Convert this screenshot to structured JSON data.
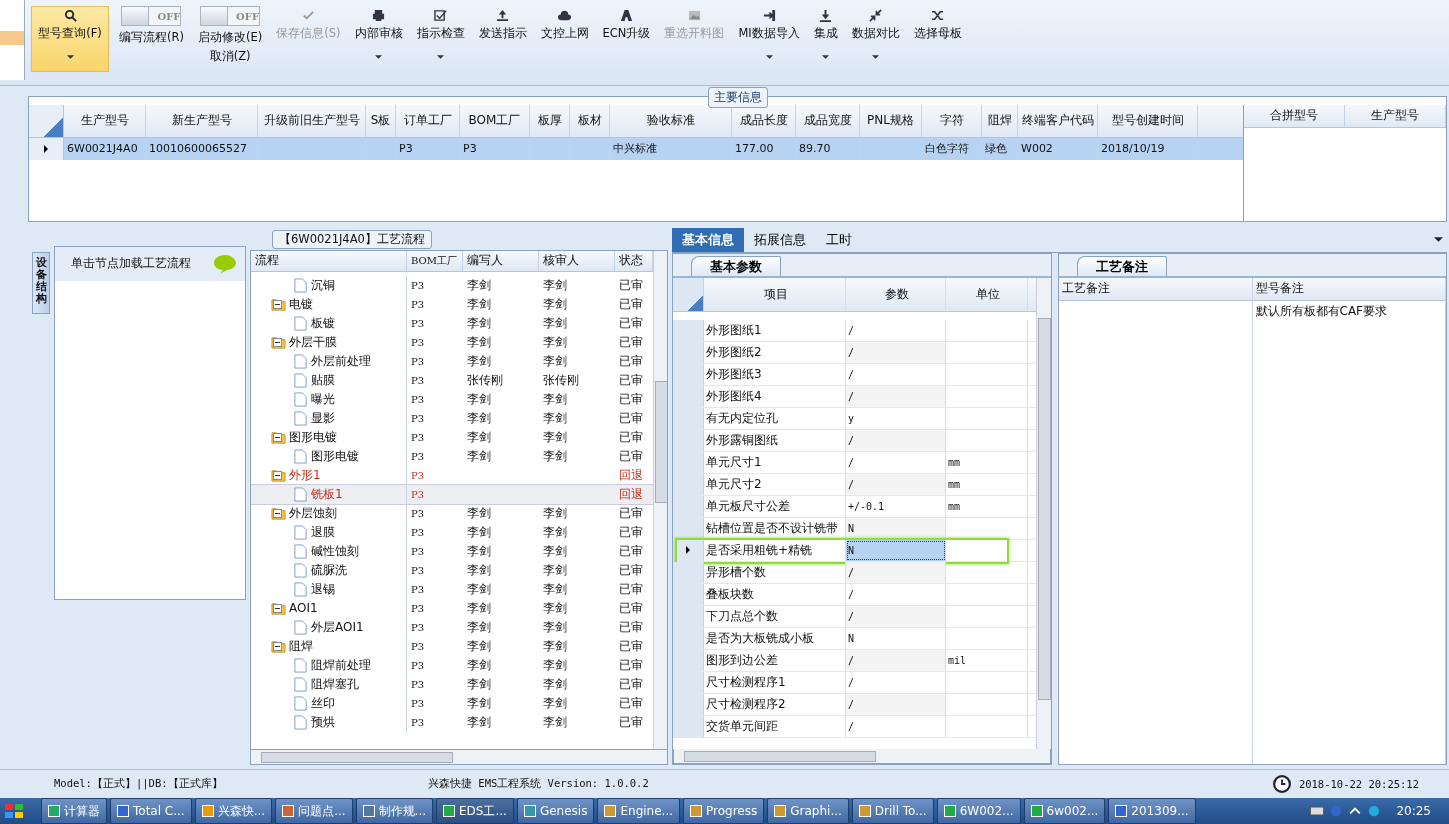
{
  "toolbar": [
    {
      "kind": "button",
      "label": "型号查询(F)",
      "selected": true,
      "disabled": false,
      "dropdown": true
    },
    {
      "kind": "toggle",
      "toggle": "OFF",
      "on": false,
      "label": "编写流程(R)"
    },
    {
      "kind": "toggle",
      "toggle": "OFF",
      "on": false,
      "label": "启动修改(E)",
      "label2": "取消(Z)"
    },
    {
      "kind": "button",
      "label": "保存信息(S)",
      "selected": false,
      "disabled": true,
      "dropdown": false
    },
    {
      "kind": "button",
      "label": "内部审核",
      "selected": false,
      "disabled": false,
      "dropdown": true
    },
    {
      "kind": "button",
      "label": "指示检查",
      "selected": false,
      "disabled": false,
      "dropdown": true
    },
    {
      "kind": "button",
      "label": "发送指示",
      "selected": false,
      "disabled": false,
      "dropdown": false
    },
    {
      "kind": "button",
      "label": "文控上网",
      "selected": false,
      "disabled": false,
      "dropdown": false
    },
    {
      "kind": "button",
      "label": "ECN升级",
      "selected": false,
      "disabled": false,
      "dropdown": false
    },
    {
      "kind": "button",
      "label": "重选开料图",
      "selected": false,
      "disabled": true,
      "dropdown": false
    },
    {
      "kind": "button",
      "label": "MI数据导入",
      "selected": false,
      "disabled": false,
      "dropdown": true
    },
    {
      "kind": "button",
      "label": "集成",
      "selected": false,
      "disabled": false,
      "dropdown": true
    },
    {
      "kind": "button",
      "label": "数据对比",
      "selected": false,
      "disabled": false,
      "dropdown": true
    },
    {
      "kind": "button",
      "label": "选择母板",
      "selected": false,
      "disabled": false,
      "dropdown": false
    }
  ],
  "main_info": {
    "title": "主要信息",
    "columns": [
      "生产型号",
      "新生产型号",
      "升级前旧生产型号",
      "S板",
      "订单工厂",
      "BOM工厂",
      "板厚",
      "板材",
      "验收标准",
      "成品长度",
      "成品宽度",
      "PNL规格",
      "字符",
      "阻焊",
      "终端客户代码",
      "型号创建时间"
    ],
    "rows": [
      {
        "selected": true,
        "cells": [
          "6W0021J4A0",
          "10010600065527",
          "",
          "",
          "P3",
          "P3",
          "",
          "",
          "中兴标准",
          "177.00",
          "89.70",
          "",
          "白色字符",
          "绿色",
          "W002",
          "2018/10/19"
        ]
      }
    ],
    "merge_columns": [
      "合拼型号",
      "生产型号"
    ]
  },
  "side_tab": "设备结构",
  "side_panel": {
    "title": "单击节点加载工艺流程"
  },
  "flow": {
    "title": "【6W0021J4A0】工艺流程",
    "columns": [
      "流程",
      "BOM工厂",
      "编写人",
      "核审人",
      "状态"
    ],
    "tree": [
      {
        "children": [
          {
            "label": "沉铜",
            "factory": "P3",
            "writer": "李剑",
            "reviewer": "李剑",
            "status": "已审",
            "returned": false,
            "selected": false
          }
        ]
      },
      {
        "label": "电镀",
        "factory": "P3",
        "writer": "李剑",
        "reviewer": "李剑",
        "status": "已审",
        "returned": false,
        "selected": false,
        "children": [
          {
            "label": "板镀",
            "factory": "P3",
            "writer": "李剑",
            "reviewer": "李剑",
            "status": "已审",
            "returned": false,
            "selected": false
          }
        ]
      },
      {
        "label": "外层干膜",
        "factory": "P3",
        "writer": "李剑",
        "reviewer": "李剑",
        "status": "已审",
        "returned": false,
        "selected": false,
        "children": [
          {
            "label": "外层前处理",
            "factory": "P3",
            "writer": "李剑",
            "reviewer": "李剑",
            "status": "已审",
            "returned": false,
            "selected": false
          },
          {
            "label": "贴膜",
            "factory": "P3",
            "writer": "张传刚",
            "reviewer": "张传刚",
            "status": "已审",
            "returned": false,
            "selected": false
          },
          {
            "label": "曝光",
            "factory": "P3",
            "writer": "李剑",
            "reviewer": "李剑",
            "status": "已审",
            "returned": false,
            "selected": false
          },
          {
            "label": "显影",
            "factory": "P3",
            "writer": "李剑",
            "reviewer": "李剑",
            "status": "已审",
            "returned": false,
            "selected": false
          }
        ]
      },
      {
        "label": "图形电镀",
        "factory": "P3",
        "writer": "李剑",
        "reviewer": "李剑",
        "status": "已审",
        "returned": false,
        "selected": false,
        "children": [
          {
            "label": "图形电镀",
            "factory": "P3",
            "writer": "李剑",
            "reviewer": "李剑",
            "status": "已审",
            "returned": false,
            "selected": false
          }
        ]
      },
      {
        "label": "外形1",
        "factory": "P3",
        "status": "回退",
        "returned": true,
        "selected": false,
        "children": [
          {
            "label": "铣板1",
            "factory": "P3",
            "status": "回退",
            "returned": true,
            "selected": true
          }
        ]
      },
      {
        "label": "外层蚀刻",
        "factory": "P3",
        "writer": "李剑",
        "reviewer": "李剑",
        "status": "已审",
        "returned": false,
        "selected": false,
        "children": [
          {
            "label": "退膜",
            "factory": "P3",
            "writer": "李剑",
            "reviewer": "李剑",
            "status": "已审",
            "returned": false,
            "selected": false
          },
          {
            "label": "碱性蚀刻",
            "factory": "P3",
            "writer": "李剑",
            "reviewer": "李剑",
            "status": "已审",
            "returned": false,
            "selected": false
          },
          {
            "label": "硫脲洗",
            "factory": "P3",
            "writer": "李剑",
            "reviewer": "李剑",
            "status": "已审",
            "returned": false,
            "selected": false
          },
          {
            "label": "退锡",
            "factory": "P3",
            "writer": "李剑",
            "reviewer": "李剑",
            "status": "已审",
            "returned": false,
            "selected": false
          }
        ]
      },
      {
        "label": "AOI1",
        "factory": "P3",
        "writer": "李剑",
        "reviewer": "李剑",
        "status": "已审",
        "returned": false,
        "selected": false,
        "children": [
          {
            "label": "外层AOI1",
            "factory": "P3",
            "writer": "李剑",
            "reviewer": "李剑",
            "status": "已审",
            "returned": false,
            "selected": false
          }
        ]
      },
      {
        "label": "阻焊",
        "factory": "P3",
        "writer": "李剑",
        "reviewer": "李剑",
        "status": "已审",
        "returned": false,
        "selected": false,
        "children": [
          {
            "label": "阻焊前处理",
            "factory": "P3",
            "writer": "李剑",
            "reviewer": "李剑",
            "status": "已审",
            "returned": false,
            "selected": false
          },
          {
            "label": "阻焊塞孔",
            "factory": "P3",
            "writer": "李剑",
            "reviewer": "李剑",
            "status": "已审",
            "returned": false,
            "selected": false
          },
          {
            "label": "丝印",
            "factory": "P3",
            "writer": "李剑",
            "reviewer": "李剑",
            "status": "已审",
            "returned": false,
            "selected": false
          },
          {
            "label": "预烘",
            "factory": "P3",
            "writer": "李剑",
            "reviewer": "李剑",
            "status": "已审",
            "returned": false,
            "selected": false
          }
        ]
      }
    ]
  },
  "tabs": [
    {
      "label": "基本信息",
      "selected": true
    },
    {
      "label": "拓展信息",
      "selected": false
    },
    {
      "label": "工时",
      "selected": false
    }
  ],
  "params": {
    "tab": "基本参数",
    "columns": [
      "项目",
      "参数",
      "单位"
    ],
    "rows": [
      {
        "item": "外形图纸1",
        "value": "/",
        "selected": false
      },
      {
        "item": "外形图纸2",
        "value": "/",
        "selected": false
      },
      {
        "item": "外形图纸3",
        "value": "/",
        "selected": false
      },
      {
        "item": "外形图纸4",
        "value": "/",
        "selected": false
      },
      {
        "item": "有无内定位孔",
        "value": "y",
        "selected": false
      },
      {
        "item": "外形露铜图纸",
        "value": "/",
        "selected": false
      },
      {
        "item": "单元尺寸1",
        "value": "/",
        "unit": "mm",
        "selected": false
      },
      {
        "item": "单元尺寸2",
        "value": "/",
        "unit": "mm",
        "selected": false
      },
      {
        "item": "单元板尺寸公差",
        "value": "+/-0.1",
        "unit": "mm",
        "selected": false
      },
      {
        "item": "钻槽位置是否不设计铣带",
        "value": "N",
        "selected": false
      },
      {
        "item": "是否采用粗铣+精铣",
        "value": "N",
        "selected": true
      },
      {
        "item": "异形槽个数",
        "value": "/",
        "selected": false
      },
      {
        "item": "叠板块数",
        "value": "/",
        "selected": false
      },
      {
        "item": "下刀点总个数",
        "value": "/",
        "selected": false
      },
      {
        "item": "是否为大板铣成小板",
        "value": "N",
        "selected": false
      },
      {
        "item": "图形到边公差",
        "value": "/",
        "unit": "mil",
        "selected": false
      },
      {
        "item": "尺寸检测程序1",
        "value": "/",
        "selected": false
      },
      {
        "item": "尺寸检测程序2",
        "value": "/",
        "selected": false
      },
      {
        "item": "交货单元间距",
        "value": "/",
        "selected": false
      }
    ]
  },
  "remarks": {
    "tab": "工艺备注",
    "columns": [
      {
        "label": "工艺备注"
      },
      {
        "label": "型号备注",
        "value": "默认所有板都有CAF要求"
      }
    ]
  },
  "status_bar": {
    "model": "Model:【正式】||DB:【正式库】",
    "app": "兴森快捷 EMS工程系统 Version: 1.0.0.2",
    "datetime": "2018-10-22 20:25:12"
  },
  "taskbar": {
    "items": [
      {
        "label": "计算器",
        "selected": false
      },
      {
        "label": "Total C...",
        "selected": false
      },
      {
        "label": "兴森快...",
        "selected": false
      },
      {
        "label": "问题点...",
        "selected": false
      },
      {
        "label": "制作规...",
        "selected": false
      },
      {
        "label": "EDS工...",
        "selected": true
      },
      {
        "label": "Genesis",
        "selected": false
      },
      {
        "label": "Engine...",
        "selected": false
      },
      {
        "label": "Progress",
        "selected": false
      },
      {
        "label": "Graphi...",
        "selected": false
      },
      {
        "label": "Drill To...",
        "selected": false
      },
      {
        "label": "6W002...",
        "selected": false
      },
      {
        "label": "6w002...",
        "selected": false
      },
      {
        "label": "201309...",
        "selected": false
      }
    ],
    "time": "20:25"
  }
}
